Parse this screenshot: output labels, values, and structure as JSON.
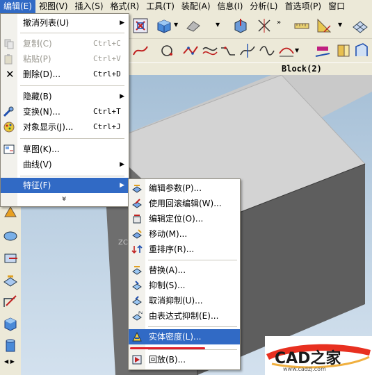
{
  "menubar": {
    "items": [
      {
        "label": "编辑(E)"
      },
      {
        "label": "视图(V)"
      },
      {
        "label": "插入(S)"
      },
      {
        "label": "格式(R)"
      },
      {
        "label": "工具(T)"
      },
      {
        "label": "装配(A)"
      },
      {
        "label": "信息(I)"
      },
      {
        "label": "分析(L)"
      },
      {
        "label": "首选项(P)"
      },
      {
        "label": "窗口"
      }
    ]
  },
  "part_title": "Block(2)",
  "edit_menu": {
    "items": [
      {
        "label": "撤消列表(U)",
        "shortcut": "",
        "submenu": true,
        "disabled": false
      },
      {
        "label": "复制(C)",
        "shortcut": "Ctrl+C",
        "submenu": false,
        "disabled": true
      },
      {
        "label": "粘贴(P)",
        "shortcut": "Ctrl+V",
        "submenu": false,
        "disabled": true
      },
      {
        "label": "删除(D)...",
        "shortcut": "Ctrl+D",
        "submenu": false,
        "disabled": false
      },
      {
        "label": "隐藏(B)",
        "shortcut": "",
        "submenu": true,
        "disabled": false
      },
      {
        "label": "变换(N)...",
        "shortcut": "Ctrl+T",
        "submenu": false,
        "disabled": false
      },
      {
        "label": "对象显示(J)...",
        "shortcut": "Ctrl+J",
        "submenu": false,
        "disabled": false
      },
      {
        "label": "草图(K)...",
        "shortcut": "",
        "submenu": false,
        "disabled": false
      },
      {
        "label": "曲线(V)",
        "shortcut": "",
        "submenu": true,
        "disabled": false
      },
      {
        "label": "特征(F)",
        "shortcut": "",
        "submenu": true,
        "disabled": false
      }
    ],
    "more": "»"
  },
  "feature_menu": {
    "items": [
      {
        "label": "编辑参数(P)..."
      },
      {
        "label": "使用回滚编辑(W)..."
      },
      {
        "label": "编辑定位(O)..."
      },
      {
        "label": "移动(M)..."
      },
      {
        "label": "重排序(R)..."
      },
      {
        "label": "替换(A)..."
      },
      {
        "label": "抑制(S)..."
      },
      {
        "label": "取消抑制(U)..."
      },
      {
        "label": "由表达式抑制(E)..."
      },
      {
        "label": "实体密度(L)..."
      },
      {
        "label": "回放(B)..."
      }
    ]
  },
  "viewport": {
    "axis_label": "ZC"
  },
  "watermark": {
    "brand": "CAD之家",
    "url": "www.cadzj.com"
  },
  "colors": {
    "highlight": "#316ac5",
    "menubar": "#ece9d8",
    "underline": "#e0202a"
  }
}
